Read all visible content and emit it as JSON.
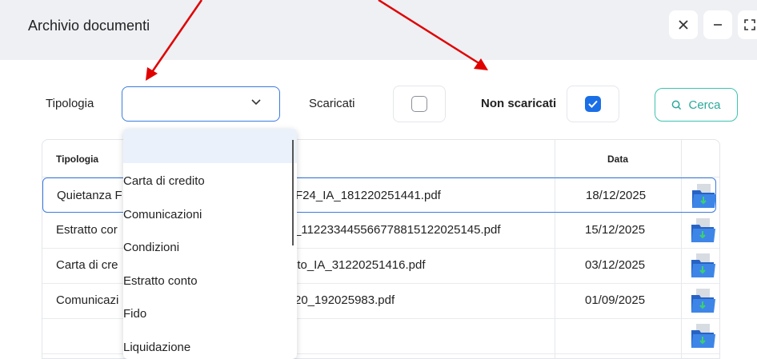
{
  "window": {
    "title": "Archivio documenti",
    "close_icon": "close-icon",
    "min_icon": "minimize-icon",
    "max_icon": "maximize-icon"
  },
  "filters": {
    "tipologia_label": "Tipologia",
    "tipologia_value": "",
    "scaricati_label": "Scaricati",
    "scaricati_checked": false,
    "non_scaricati_label": "Non scaricati",
    "non_scaricati_checked": true,
    "search_button": "Cerca"
  },
  "dropdown": {
    "options": [
      "",
      "Carta di credito",
      "Comunicazioni",
      "Condizioni",
      "Estratto conto",
      "Fido",
      "Liquidazione"
    ]
  },
  "table": {
    "headers": [
      "Tipologia",
      "",
      "Data",
      ""
    ],
    "rows": [
      {
        "tipologia": "Quietanza F",
        "file": "F24_IA_181220251441.pdf",
        "data": "18/12/2025"
      },
      {
        "tipologia": "Estratto cor",
        "file": "_112233445566778815122025145.pdf",
        "data": "15/12/2025"
      },
      {
        "tipologia": "Carta di cre",
        "file": "ito_IA_31220251416.pdf",
        "data": "03/12/2025"
      },
      {
        "tipologia": "Comunicazi",
        "file": "20_192025983.pdf",
        "data": "01/09/2025"
      },
      {
        "tipologia": "",
        "file": "",
        "data": ""
      }
    ]
  },
  "colors": {
    "accent": "#1a6fe6",
    "teal": "#3cc3b0",
    "annotation_arrow": "#e00000"
  }
}
